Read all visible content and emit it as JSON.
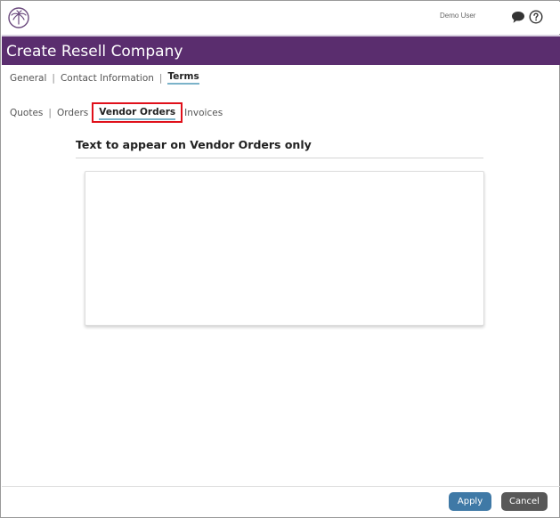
{
  "user": {
    "name": "Demo User"
  },
  "page": {
    "title": "Create Resell Company"
  },
  "primary_tabs": [
    {
      "label": "General"
    },
    {
      "label": "Contact Information"
    },
    {
      "label": "Terms",
      "active": true
    }
  ],
  "secondary_tabs": [
    {
      "label": "Quotes"
    },
    {
      "label": "Orders"
    },
    {
      "label": "Vendor Orders",
      "active": true,
      "highlighted": true
    },
    {
      "label": "Invoices"
    }
  ],
  "section": {
    "title": "Text to appear on Vendor Orders only",
    "text_value": ""
  },
  "footer": {
    "apply_label": "Apply",
    "cancel_label": "Cancel"
  },
  "colors": {
    "header": "#5a2d6e",
    "apply": "#3f79a6",
    "cancel": "#585858",
    "highlight": "#e0101a",
    "tab_underline": "#7bb3c9"
  },
  "icons": {
    "logo": "palm-tree-logo-icon",
    "chat": "chat-bubble-icon",
    "help": "help-circle-icon"
  }
}
